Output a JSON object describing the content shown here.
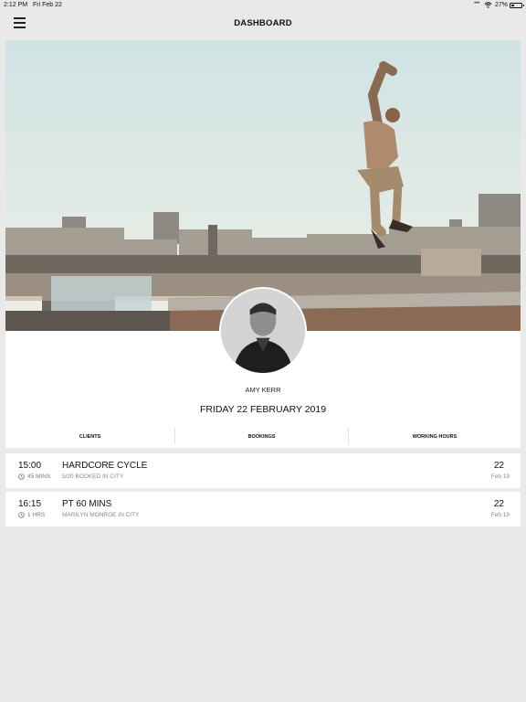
{
  "status_bar": {
    "time": "2:12 PM",
    "date": "Fri Feb 22",
    "battery": "27%",
    "battery_level": 0.27
  },
  "header": {
    "title": "DASHBOARD",
    "menu_icon": "hamburger-menu-icon"
  },
  "profile": {
    "name": "AMY KERR",
    "date": "FRIDAY 22 FEBRUARY 2019"
  },
  "tabs": [
    {
      "label": "CLIENTS"
    },
    {
      "label": "BOOKINGS"
    },
    {
      "label": "WORKING HOURS"
    }
  ],
  "bookings": [
    {
      "time": "15:00",
      "duration": "45 MINS",
      "title": "HARDCORE CYCLE",
      "subtitle": "5/20 BOOKED IN CITY",
      "day": "22",
      "month": "Feb 19"
    },
    {
      "time": "16:15",
      "duration": "1 HRS",
      "title": "PT 60 MINS",
      "subtitle": "MARILYN MONROE IN CITY",
      "day": "22",
      "month": "Feb 19"
    }
  ],
  "icons": {
    "clock": "clock-icon",
    "wifi": "wifi-icon",
    "battery": "battery-icon"
  },
  "colors": {
    "background": "#e9e9e9",
    "card": "#ffffff",
    "text": "#111111",
    "muted": "#888888"
  }
}
